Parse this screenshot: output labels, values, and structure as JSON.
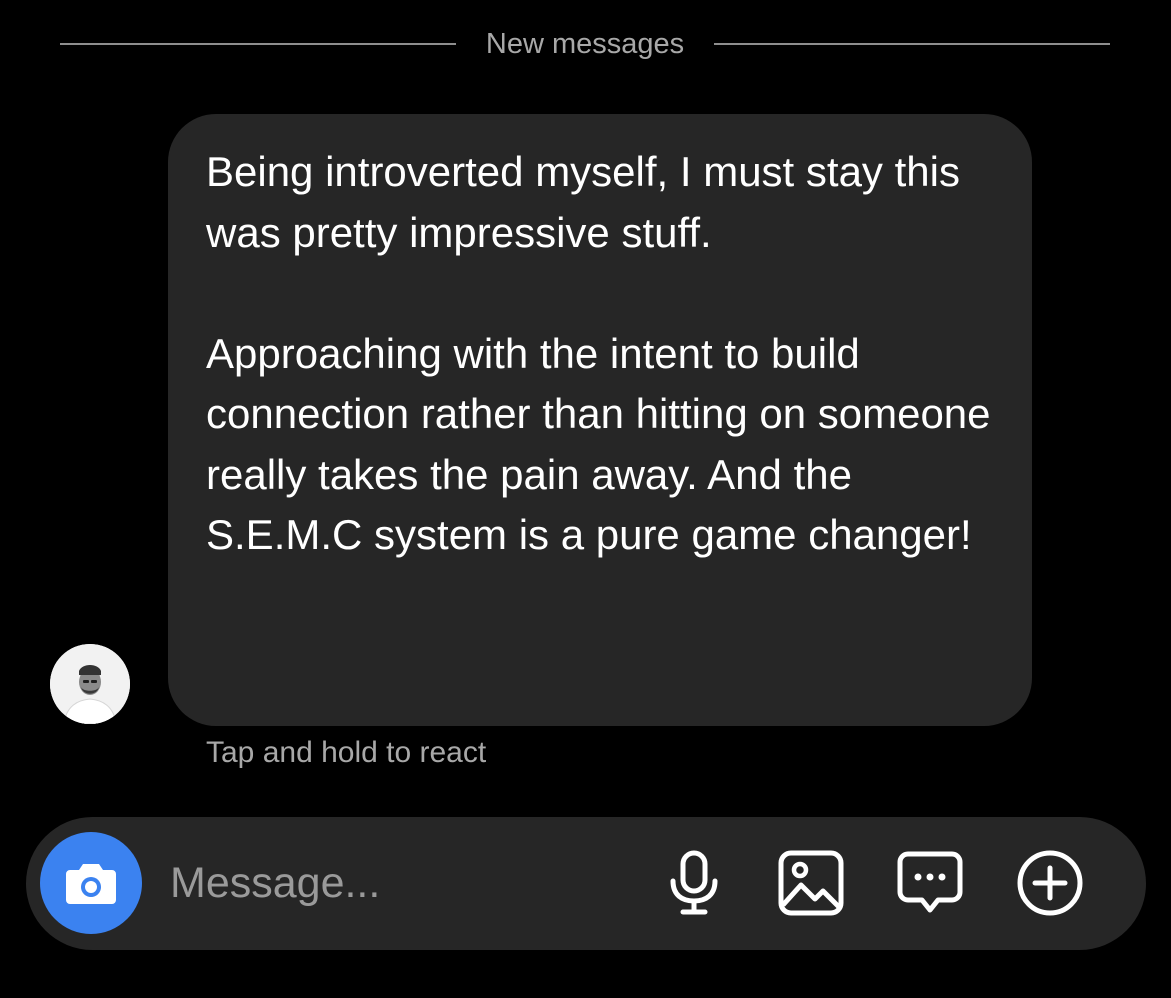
{
  "divider": {
    "label": "New messages"
  },
  "message": {
    "paragraphs": [
      "Being introverted myself, I must stay this was pretty impressive stuff.",
      "Approaching with the intent to build connection rather than hitting on someone really takes the pain away. And the S.E.M.C system is a pure game changer!"
    ],
    "hint": "Tap and hold to react"
  },
  "composer": {
    "placeholder": "Message...",
    "value": "",
    "icons": {
      "camera": "camera-icon",
      "mic": "microphone-icon",
      "gallery": "image-icon",
      "sticker": "chat-bubble-icon",
      "more": "plus-circle-icon"
    }
  },
  "colors": {
    "background": "#000000",
    "bubble": "#262626",
    "composer": "#262626",
    "camera_button": "#3b82f0",
    "muted_text": "#a8a8a8"
  }
}
